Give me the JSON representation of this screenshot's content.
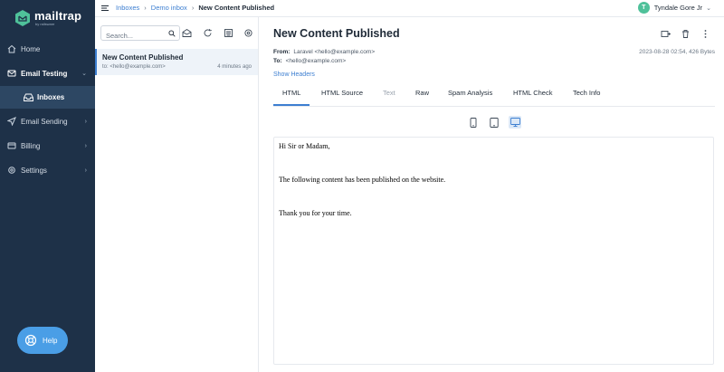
{
  "brand": {
    "name": "mailtrap",
    "sub": "by railsware",
    "color": "#4fc19a"
  },
  "sidebar": {
    "items": [
      {
        "label": "Home",
        "icon": "home-icon"
      },
      {
        "label": "Email Testing",
        "icon": "email-testing-icon",
        "expanded": true
      },
      {
        "label": "Inboxes",
        "icon": "inbox-icon",
        "selected": true
      },
      {
        "label": "Email Sending",
        "icon": "send-icon"
      },
      {
        "label": "Billing",
        "icon": "billing-icon"
      },
      {
        "label": "Settings",
        "icon": "gear-icon"
      }
    ],
    "help_label": "Help"
  },
  "topbar": {
    "breadcrumb": [
      "Inboxes",
      "Demo inbox",
      "New Content Published"
    ],
    "user_name": "Tyndale Gore Jr",
    "user_initial": "T"
  },
  "list": {
    "search_placeholder": "Search...",
    "messages": [
      {
        "subject": "New Content Published",
        "to": "to: <hello@example.com>",
        "time": "4 minutes ago"
      }
    ]
  },
  "message": {
    "subject": "New Content Published",
    "from_label": "From:",
    "from_value": "Laravel <hello@example.com>",
    "to_label": "To:",
    "to_value": "<hello@example.com>",
    "meta": "2023-08-28 02:54, 426 Bytes",
    "show_headers": "Show Headers",
    "tabs": [
      "HTML",
      "HTML Source",
      "Text",
      "Raw",
      "Spam Analysis",
      "HTML Check",
      "Tech Info"
    ],
    "active_tab": "HTML",
    "body": [
      "Hi Sir or Madam,",
      "The following content has been published on the website.",
      "Thank you for your time."
    ]
  },
  "colors": {
    "sidebar_bg": "#1e3148",
    "accent": "#3d7fd1",
    "help_button": "#4a9ee6"
  }
}
